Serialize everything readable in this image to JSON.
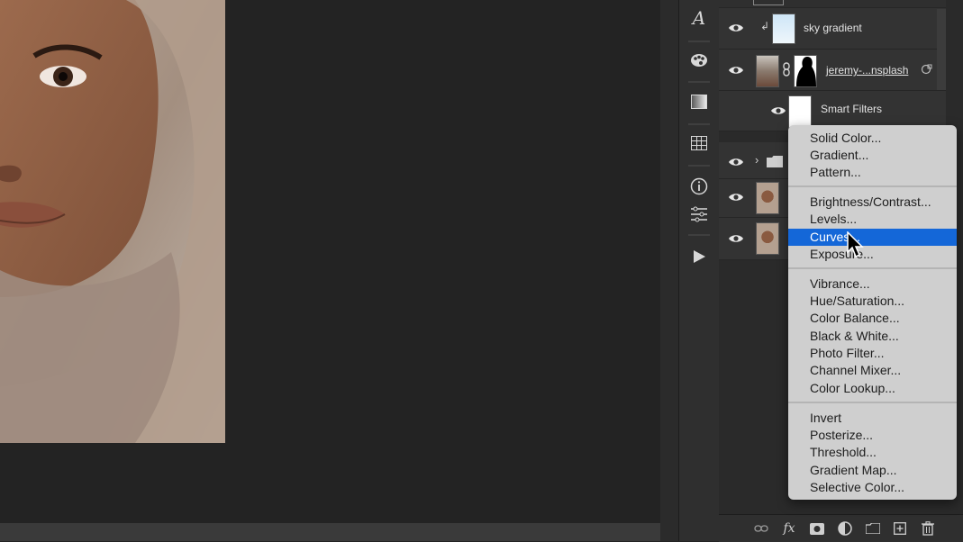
{
  "layers": [
    {
      "name": "sky gradient",
      "visible": true,
      "clipped": true
    },
    {
      "name": "jeremy-...nsplash",
      "visible": true,
      "linked_mask": true
    },
    {
      "name": "Smart Filters",
      "visible": true
    }
  ],
  "menu": {
    "groups": [
      [
        "Solid Color...",
        "Gradient...",
        "Pattern..."
      ],
      [
        "Brightness/Contrast...",
        "Levels...",
        "Curves...",
        "Exposure..."
      ],
      [
        "Vibrance...",
        "Hue/Saturation...",
        "Color Balance...",
        "Black & White...",
        "Photo Filter...",
        "Channel Mixer...",
        "Color Lookup..."
      ],
      [
        "Invert",
        "Posterize...",
        "Threshold...",
        "Gradient Map...",
        "Selective Color..."
      ]
    ],
    "selected": "Curves..."
  },
  "colors": {
    "menu_highlight": "#1467d8",
    "panel_bg": "#2a2a2a",
    "canvas_bg": "#232323"
  },
  "bottom_bar": {
    "fx_label": "fx"
  }
}
